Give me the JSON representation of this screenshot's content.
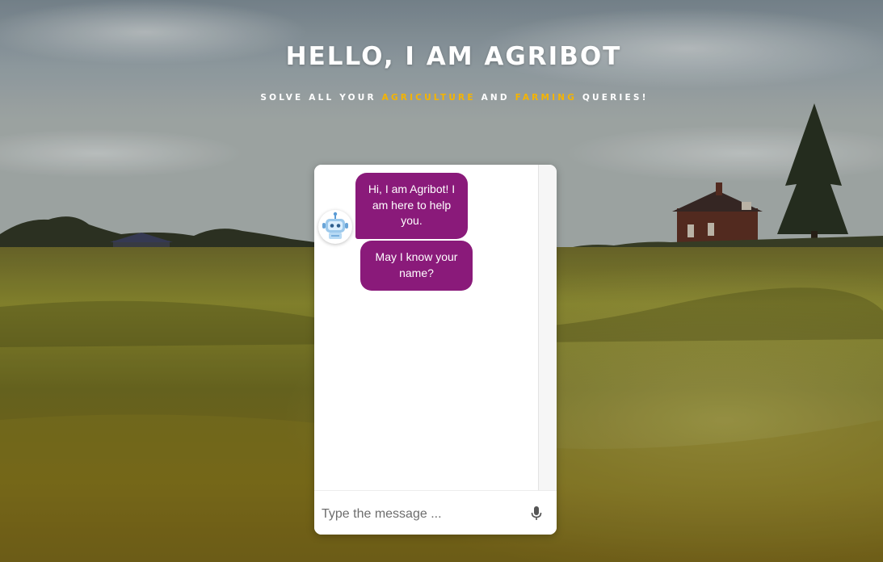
{
  "header": {
    "title": "HELLO, I AM AGRIBOT",
    "subtitle": {
      "part1": "SOLVE ALL YOUR ",
      "highlight1": "AGRICULTURE",
      "part2": " AND ",
      "highlight2": "FARMING",
      "part3": " QUERIES!"
    }
  },
  "chat": {
    "bot_avatar_icon": "robot-icon",
    "messages": [
      {
        "from": "bot",
        "text": "Hi, I am Agribot! I am here to help you."
      },
      {
        "from": "bot",
        "text": "May I know your name?"
      }
    ],
    "input": {
      "placeholder": "Type the message ...",
      "value": ""
    },
    "mic_icon": "microphone-icon"
  },
  "colors": {
    "accent_highlight": "#f5b400",
    "bubble_bg": "#8a1a7a",
    "title_text": "#ffffff"
  }
}
